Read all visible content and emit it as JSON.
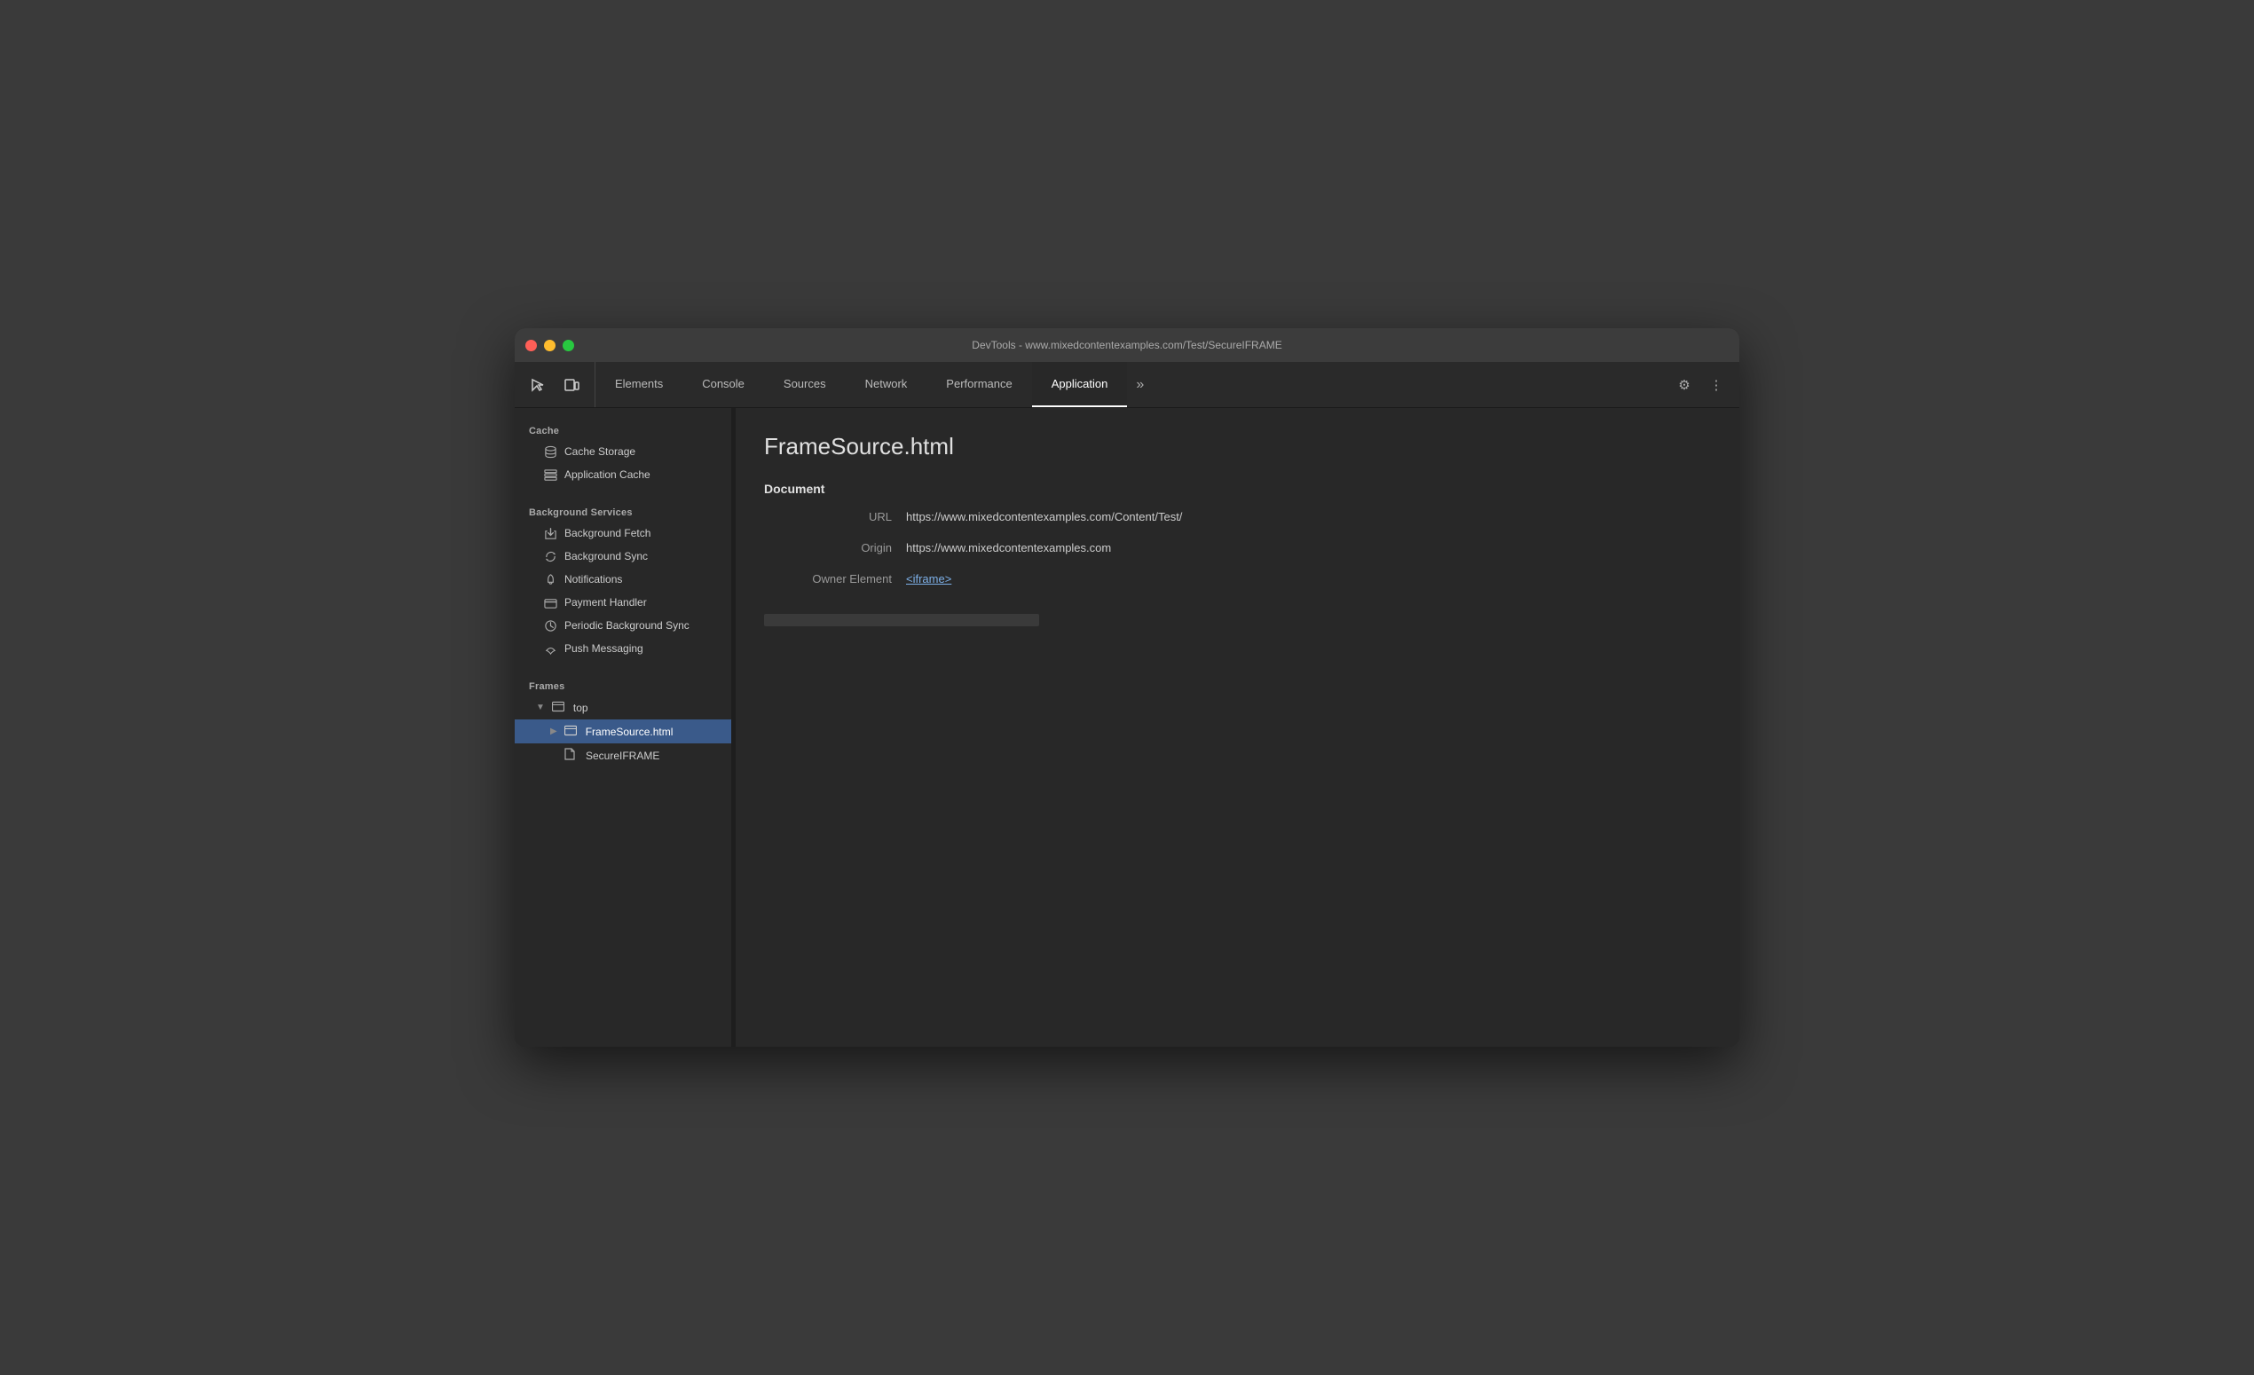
{
  "window": {
    "title": "DevTools - www.mixedcontentexamples.com/Test/SecureIFRAME"
  },
  "toolbar": {
    "tabs": [
      {
        "id": "elements",
        "label": "Elements",
        "active": false
      },
      {
        "id": "console",
        "label": "Console",
        "active": false
      },
      {
        "id": "sources",
        "label": "Sources",
        "active": false
      },
      {
        "id": "network",
        "label": "Network",
        "active": false
      },
      {
        "id": "performance",
        "label": "Performance",
        "active": false
      },
      {
        "id": "application",
        "label": "Application",
        "active": true
      }
    ],
    "more_label": "»",
    "settings_icon": "⚙",
    "dots_icon": "⋮"
  },
  "sidebar": {
    "sections": [
      {
        "id": "cache",
        "header": "Cache",
        "items": [
          {
            "id": "cache-storage",
            "label": "Cache Storage",
            "icon": "db"
          },
          {
            "id": "application-cache",
            "label": "Application Cache",
            "icon": "grid"
          }
        ]
      },
      {
        "id": "background-services",
        "header": "Background Services",
        "items": [
          {
            "id": "background-fetch",
            "label": "Background Fetch",
            "icon": "arrows"
          },
          {
            "id": "background-sync",
            "label": "Background Sync",
            "icon": "sync"
          },
          {
            "id": "notifications",
            "label": "Notifications",
            "icon": "bell"
          },
          {
            "id": "payment-handler",
            "label": "Payment Handler",
            "icon": "card"
          },
          {
            "id": "periodic-background-sync",
            "label": "Periodic Background Sync",
            "icon": "clock"
          },
          {
            "id": "push-messaging",
            "label": "Push Messaging",
            "icon": "cloud"
          }
        ]
      },
      {
        "id": "frames",
        "header": "Frames",
        "items": []
      }
    ],
    "frames_tree": [
      {
        "id": "top",
        "label": "top",
        "level": 1,
        "expanded": true,
        "arrow": "▼",
        "type": "folder"
      },
      {
        "id": "framesource",
        "label": "FrameSource.html",
        "level": 2,
        "expanded": false,
        "arrow": "▶",
        "type": "folder",
        "selected": true
      },
      {
        "id": "secureiframe",
        "label": "SecureIFRAME",
        "level": 3,
        "arrow": "",
        "type": "file"
      }
    ]
  },
  "content": {
    "title": "FrameSource.html",
    "section_header": "Document",
    "fields": [
      {
        "label": "URL",
        "value": "https://www.mixedcontentexamples.com/Content/Test/",
        "type": "text"
      },
      {
        "label": "Origin",
        "value": "https://www.mixedcontentexamples.com",
        "type": "text"
      },
      {
        "label": "Owner Element",
        "value": "<iframe>",
        "type": "link"
      }
    ]
  }
}
